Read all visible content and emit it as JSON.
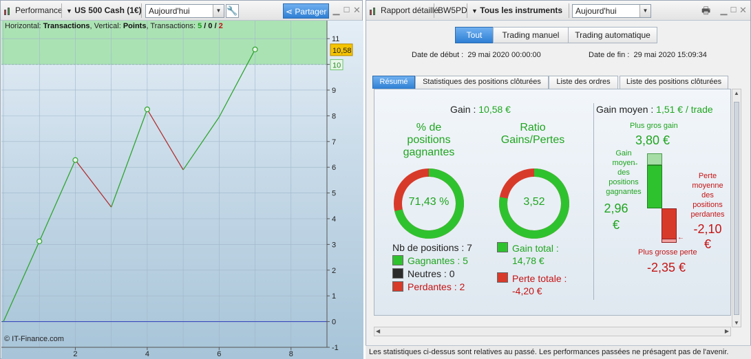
{
  "left": {
    "title": "Performance",
    "instrument": "US 500 Cash (1€)",
    "period": "Aujourd'hui",
    "share_label": "Partager",
    "info": {
      "horizontal_label": "Horizontal:",
      "horizontal_value": "Transactions",
      "vertical_label": "Vertical:",
      "vertical_value": "Points",
      "transactions_label": "Transactions:",
      "won": "5",
      "neutral": "0",
      "lost": "2",
      "slash": "/"
    },
    "copyright": "© IT-Finance.com",
    "current_value_badge": "10,58",
    "target_badge": "10"
  },
  "chart_data": {
    "type": "line",
    "x": [
      0,
      1,
      2,
      3,
      4,
      5,
      6,
      7
    ],
    "y": [
      0,
      3.12,
      6.28,
      4.45,
      8.25,
      5.9,
      7.95,
      10.58
    ],
    "markers": [
      1,
      2,
      4,
      7
    ],
    "xticks": [
      "2",
      "4",
      "6",
      "8"
    ],
    "yticks": [
      "11",
      "10",
      "9",
      "8",
      "7",
      "6",
      "5",
      "4",
      "3",
      "2",
      "1",
      "0",
      "-1"
    ],
    "xlim": [
      0,
      9
    ],
    "ylim": [
      -1,
      11.7
    ],
    "target_line": 10,
    "colors": {
      "up": "#2ea52e",
      "down": "#b03030",
      "zero": "#2a3ab8",
      "band": "#9ee0a4"
    }
  },
  "right": {
    "title": "Rapport détaillé",
    "account": "BW5PD",
    "instruments": "Tous les instruments",
    "period": "Aujourd'hui",
    "tabs": [
      "Tout",
      "Trading manuel",
      "Trading automatique"
    ],
    "start_label": "Date de début :",
    "start_value": "29 mai 2020 00:00:00",
    "end_label": "Date de fin :",
    "end_value": "29 mai 2020 15:09:34",
    "subtabs": [
      "Résumé",
      "Statistiques des positions clôturées",
      "Liste des ordres",
      "Liste des positions clôturées"
    ],
    "gain_label": "Gain :",
    "gain_value": "10,58 €",
    "winpct_title_1": "% de",
    "winpct_title_2": "positions",
    "winpct_title_3": "gagnantes",
    "winpct_value": "71,43 %",
    "winpct_fraction": 0.7143,
    "ratio_title_1": "Ratio",
    "ratio_title_2": "Gains/Pertes",
    "ratio_value": "3,52",
    "ratio_fraction": 0.779,
    "nb_label": "Nb de positions : 7",
    "gagnantes": "Gagnantes : 5",
    "neutres": "Neutres : 0",
    "perdantes": "Perdantes : 2",
    "gain_total_1": "Gain total :",
    "gain_total_2": "14,78 €",
    "perte_totale_1": "Perte totale :",
    "perte_totale_2": "-4,20 €",
    "avg_label": "Gain moyen :",
    "avg_value": "1,51 € / trade",
    "max_gain_label": "Plus gros gain",
    "max_gain_value": "3,80 €",
    "avg_win_1": "Gain",
    "avg_win_2": "moyen",
    "avg_win_3": "des",
    "avg_win_4": "positions",
    "avg_win_5": "gagnantes",
    "avg_win_value_1": "2,96",
    "avg_win_value_2": "€",
    "avg_loss_1": "Perte",
    "avg_loss_2": "moyenne",
    "avg_loss_3": "des",
    "avg_loss_4": "positions",
    "avg_loss_5": "perdantes",
    "avg_loss_value_1": "-2,10",
    "avg_loss_value_2": "€",
    "max_loss_label": "Plus grosse perte",
    "max_loss_value": "-2,35 €",
    "status": "Les statistiques ci-dessus sont relatives au passé. Les performances passées ne présagent pas de l'avenir."
  }
}
